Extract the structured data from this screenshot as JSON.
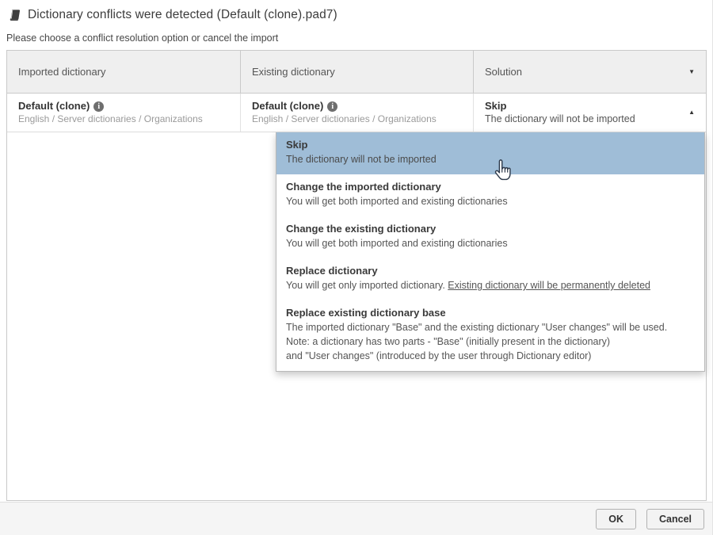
{
  "dialog": {
    "title": "Dictionary conflicts were detected (Default (clone).pad7)",
    "subtitle": "Please choose a conflict resolution option or cancel the import"
  },
  "table": {
    "headers": [
      "Imported dictionary",
      "Existing dictionary",
      "Solution"
    ],
    "row": {
      "imported": {
        "name": "Default (clone)",
        "path": "English / Server dictionaries / Organizations"
      },
      "existing": {
        "name": "Default (clone)",
        "path": "English / Server dictionaries / Organizations"
      },
      "solution": {
        "name": "Skip",
        "desc": "The dictionary will not be imported"
      }
    }
  },
  "dropdown": {
    "options": [
      {
        "title": "Skip",
        "desc": "The dictionary will not be imported"
      },
      {
        "title": "Change the imported dictionary",
        "desc": "You will get both imported and existing dictionaries"
      },
      {
        "title": "Change the existing dictionary",
        "desc": "You will get both imported and existing dictionaries"
      },
      {
        "title": "Replace dictionary",
        "desc": "You will get only imported dictionary. ",
        "desc_underlined": "Existing dictionary will be permanently deleted"
      },
      {
        "title": "Replace existing dictionary base",
        "desc_lines": [
          "The imported dictionary \"Base\" and the existing dictionary \"User changes\" will be used.",
          "Note: a dictionary has two parts - \"Base\" (initially present in the dictionary)",
          "and \"User changes\" (introduced by the user through Dictionary editor)"
        ]
      }
    ]
  },
  "buttons": {
    "ok": "OK",
    "cancel": "Cancel"
  },
  "icons": {
    "caret_down": "▼",
    "caret_up": "▲",
    "info": "i"
  },
  "colors": {
    "highlight": "#9fbdd7",
    "header_bg": "#efefef",
    "footer_bg": "#f5f5f5"
  }
}
